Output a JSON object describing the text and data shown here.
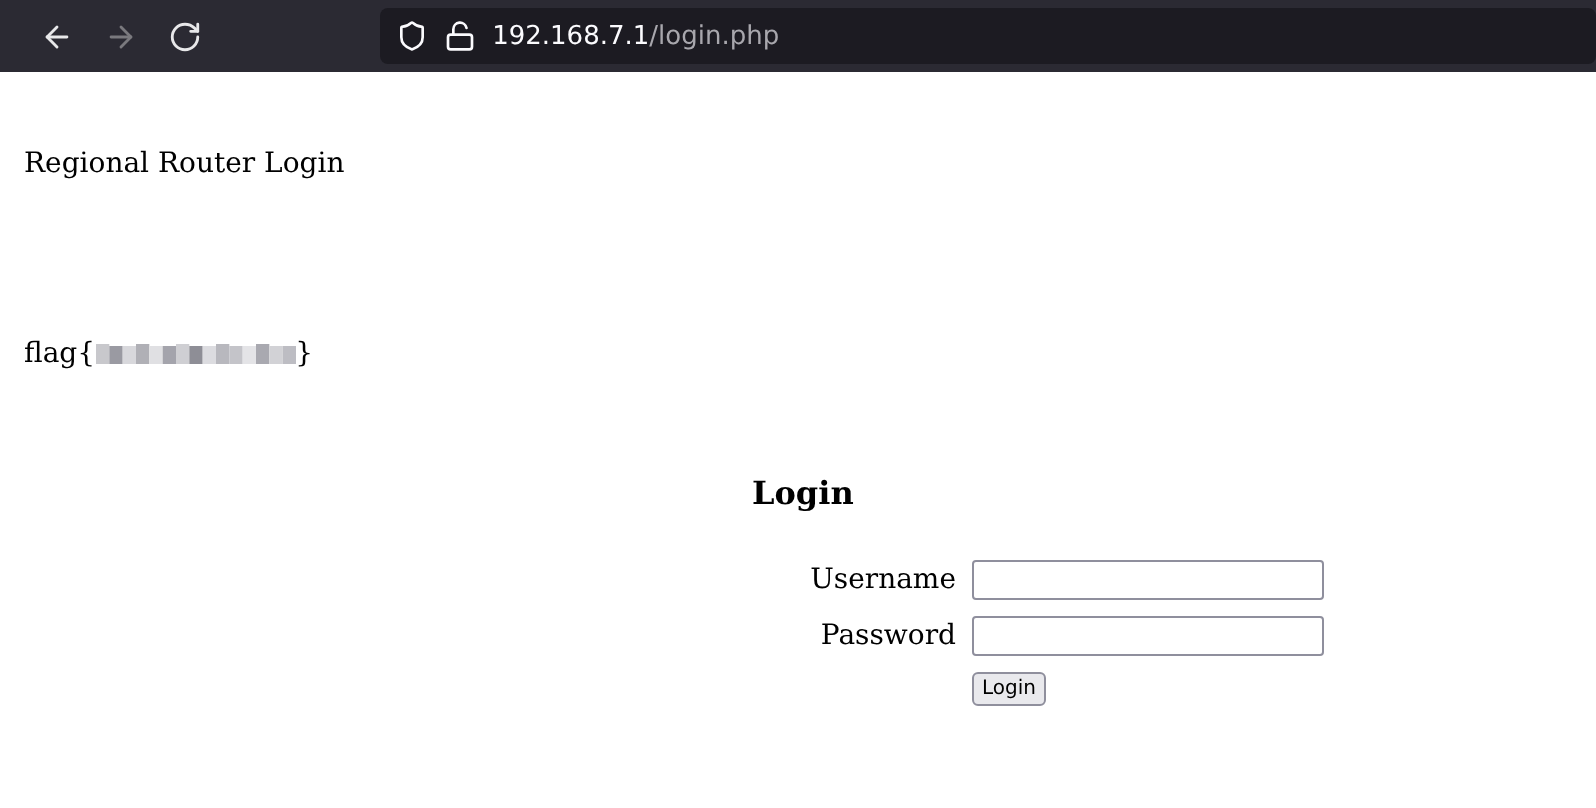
{
  "toolbar": {
    "nav_buttons": [
      {
        "kind": "back",
        "disabled": false
      },
      {
        "kind": "forward",
        "disabled": true
      },
      {
        "kind": "reload",
        "disabled": false
      }
    ],
    "address": {
      "host": "192.168.7.1",
      "path": "/login.php"
    }
  },
  "page": {
    "title": "Regional Router Login",
    "flag": {
      "prefix": "flag{",
      "suffix": "}"
    },
    "form": {
      "heading": "Login",
      "fields": [
        {
          "label": "Username"
        },
        {
          "label": "Password"
        }
      ],
      "submit": "Login"
    }
  }
}
